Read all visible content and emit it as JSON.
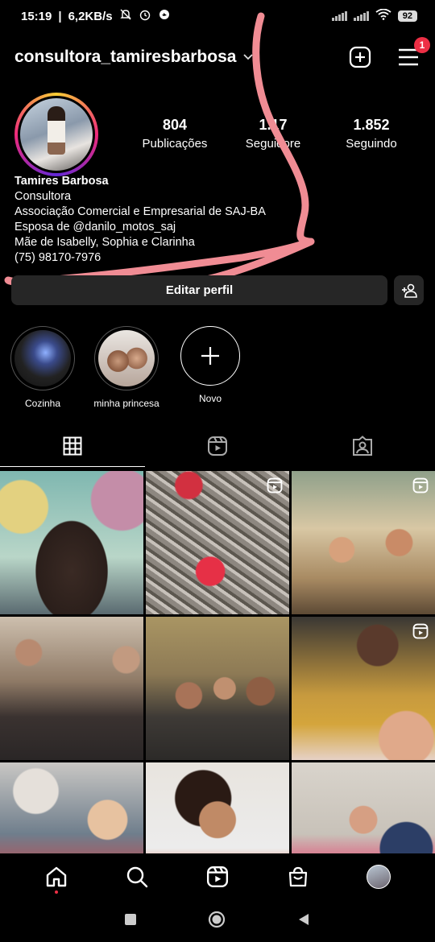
{
  "status_bar": {
    "time": "15:19",
    "speed": "6,2KB/s",
    "battery": "92"
  },
  "header": {
    "username": "consultora_tamiresbarbosa",
    "notifications_count": "1"
  },
  "stats": [
    {
      "value": "804",
      "label": "Publicações"
    },
    {
      "value": "1.17",
      "label": "Seguidore"
    },
    {
      "value": "1.852",
      "label": "Seguindo"
    }
  ],
  "bio": {
    "name": "Tamires Barbosa",
    "lines": [
      "Consultora",
      "Associação Comercial e Empresarial de SAJ-BA",
      "Esposa de @danilo_motos_saj",
      "Mãe de Isabelly, Sophia e Clarinha",
      "(75) 98170-7976"
    ]
  },
  "actions": {
    "edit_profile": "Editar perfil"
  },
  "highlights": [
    {
      "label": "Cozinha"
    },
    {
      "label": "minha princesa"
    },
    {
      "label": "Novo"
    }
  ],
  "icons": {
    "create": "plus-square-icon",
    "menu": "hamburger-menu-icon",
    "add_user": "add-user-icon",
    "grid_tab": "grid-icon",
    "reels_tab": "reels-icon",
    "tagged_tab": "tagged-icon"
  },
  "colors": {
    "badge": "#ed2f45",
    "scribble": "#f08c94",
    "button_bg": "#262626"
  }
}
